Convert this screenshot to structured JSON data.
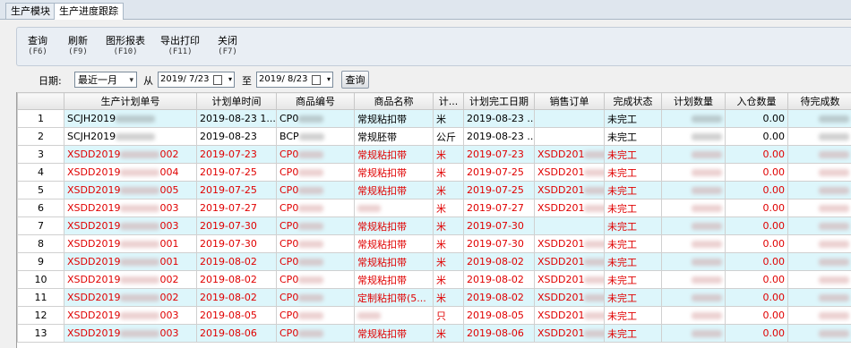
{
  "tabs": [
    {
      "label": "生产模块",
      "active": false
    },
    {
      "label": "生产进度跟踪",
      "active": true
    }
  ],
  "toolbar": [
    {
      "name": "query-button",
      "label": "查询",
      "key": "(F6)"
    },
    {
      "name": "refresh-button",
      "label": "刷新",
      "key": "(F9)"
    },
    {
      "name": "chart-report-button",
      "label": "图形报表",
      "key": "(F10)"
    },
    {
      "name": "export-print-button",
      "label": "导出打印",
      "key": "(F11)"
    },
    {
      "name": "close-button",
      "label": "关闭",
      "key": "(F7)"
    }
  ],
  "filter": {
    "date_label": "日期:",
    "range_value": "最近一月",
    "from_label": "从",
    "from_date": "2019/ 7/23",
    "to_label": "至",
    "to_date": "2019/ 8/23",
    "query_label": "查询"
  },
  "table": {
    "columns": [
      "",
      "生产计划单号",
      "计划单时间",
      "商品编号",
      "商品名称",
      "计...",
      "计划完工日期",
      "销售订单",
      "完成状态",
      "计划数量",
      "入仓数量",
      "待完成数"
    ],
    "rows": [
      {
        "n": "1",
        "plan": "SCJH2019",
        "plan_tail": "",
        "time": "2019-08-23 1...",
        "code": "CP0",
        "name": "常规粘扣带",
        "unit": "米",
        "done": "2019-08-23 ...",
        "order": "",
        "order_head": "",
        "status": "未完工",
        "inq": "0.00",
        "red": false
      },
      {
        "n": "2",
        "plan": "SCJH2019",
        "plan_tail": "",
        "time": "2019-08-23",
        "code": "BCP",
        "name": "常规胚带",
        "unit": "公斤",
        "done": "2019-08-23 ...",
        "order": "",
        "order_head": "",
        "status": "未完工",
        "inq": "0.00",
        "red": false
      },
      {
        "n": "3",
        "plan": "XSDD2019",
        "plan_tail": "002",
        "time": "2019-07-23",
        "code": "CP0",
        "name": "常规粘扣带",
        "unit": "米",
        "done": "2019-07-23",
        "order": "",
        "order_head": "XSDD201",
        "status": "未完工",
        "inq": "0.00",
        "red": true
      },
      {
        "n": "4",
        "plan": "XSDD2019",
        "plan_tail": "004",
        "time": "2019-07-25",
        "code": "CP0",
        "name": "常规粘扣带",
        "unit": "米",
        "done": "2019-07-25",
        "order": "",
        "order_head": "XSDD201",
        "status": "未完工",
        "inq": "0.00",
        "red": true
      },
      {
        "n": "5",
        "plan": "XSDD2019",
        "plan_tail": "005",
        "time": "2019-07-25",
        "code": "CP0",
        "name": "常规粘扣带",
        "unit": "米",
        "done": "2019-07-25",
        "order": "",
        "order_head": "XSDD201",
        "status": "未完工",
        "inq": "0.00",
        "red": true
      },
      {
        "n": "6",
        "plan": "XSDD2019",
        "plan_tail": "003",
        "time": "2019-07-27",
        "code": "CP0",
        "name": "",
        "unit": "米",
        "done": "2019-07-27",
        "order": "",
        "order_head": "XSDD201",
        "status": "未完工",
        "inq": "0.00",
        "red": true
      },
      {
        "n": "7",
        "plan": "XSDD2019",
        "plan_tail": "003",
        "time": "2019-07-30",
        "code": "CP0",
        "name": "常规粘扣带",
        "unit": "米",
        "done": "2019-07-30",
        "order": "",
        "order_head": "",
        "status": "未完工",
        "inq": "0.00",
        "red": true
      },
      {
        "n": "8",
        "plan": "XSDD2019",
        "plan_tail": "001",
        "time": "2019-07-30",
        "code": "CP0",
        "name": "常规粘扣带",
        "unit": "米",
        "done": "2019-07-30",
        "order": "",
        "order_head": "XSDD201",
        "status": "未完工",
        "inq": "0.00",
        "red": true
      },
      {
        "n": "9",
        "plan": "XSDD2019",
        "plan_tail": "001",
        "time": "2019-08-02",
        "code": "CP0",
        "name": "常规粘扣带",
        "unit": "米",
        "done": "2019-08-02",
        "order": "",
        "order_head": "XSDD201",
        "status": "未完工",
        "inq": "0.00",
        "red": true
      },
      {
        "n": "10",
        "plan": "XSDD2019",
        "plan_tail": "002",
        "time": "2019-08-02",
        "code": "CP0",
        "name": "常规粘扣带",
        "unit": "米",
        "done": "2019-08-02",
        "order": "",
        "order_head": "XSDD201",
        "status": "未完工",
        "inq": "0.00",
        "red": true
      },
      {
        "n": "11",
        "plan": "XSDD2019",
        "plan_tail": "002",
        "time": "2019-08-02",
        "code": "CP0",
        "name": "定制粘扣带(5...",
        "unit": "米",
        "done": "2019-08-02",
        "order": "",
        "order_head": "XSDD201",
        "status": "未完工",
        "inq": "0.00",
        "red": true
      },
      {
        "n": "12",
        "plan": "XSDD2019",
        "plan_tail": "003",
        "time": "2019-08-05",
        "code": "CP0",
        "name": "",
        "unit": "只",
        "done": "2019-08-05",
        "order": "",
        "order_head": "XSDD201",
        "status": "未完工",
        "inq": "0.00",
        "red": true
      },
      {
        "n": "13",
        "plan": "XSDD2019",
        "plan_tail": "003",
        "time": "2019-08-06",
        "code": "CP0",
        "name": "常规粘扣带",
        "unit": "米",
        "done": "2019-08-06",
        "order": "",
        "order_head": "XSDD201",
        "status": "未完工",
        "inq": "0.00",
        "red": true
      }
    ]
  }
}
